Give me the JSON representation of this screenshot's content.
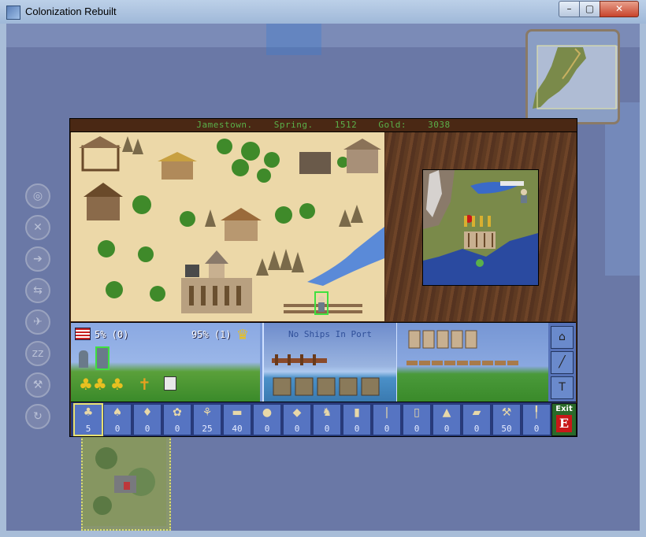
{
  "window": {
    "title": "Colonization Rebuilt",
    "minimize": "–",
    "maximize": "▢",
    "close": "✕"
  },
  "colony": {
    "name": "Jamestown.",
    "season": "Spring.",
    "year": "1512",
    "gold_label": "Gold:",
    "gold_value": "3038"
  },
  "side_buttons": [
    {
      "icon": "target-icon",
      "glyph": "◎"
    },
    {
      "icon": "crossed-tools-icon",
      "glyph": "✕"
    },
    {
      "icon": "arrow-icon",
      "glyph": "➔"
    },
    {
      "icon": "fork-arrows-icon",
      "glyph": "⇆"
    },
    {
      "icon": "bird-icon",
      "glyph": "✈"
    },
    {
      "icon": "sleep-icon",
      "glyph": "zz"
    },
    {
      "icon": "plow-icon",
      "glyph": "⚒"
    },
    {
      "icon": "cycle-icon",
      "glyph": "↻"
    }
  ],
  "status": {
    "rebels_pct": "5% (0)",
    "tories_pct": "95% (1)",
    "no_ships": "No Ships In Port"
  },
  "panel_buttons": [
    {
      "icon": "building-icon",
      "glyph": "⌂"
    },
    {
      "icon": "musket-icon",
      "glyph": "╱"
    },
    {
      "icon": "hammer-icon",
      "glyph": "T"
    }
  ],
  "goods": [
    {
      "name": "food",
      "icon": "corn-icon",
      "glyph": "♣",
      "value": "5"
    },
    {
      "name": "sugar",
      "icon": "sugar-icon",
      "glyph": "♠",
      "value": "0"
    },
    {
      "name": "tobacco",
      "icon": "tobacco-icon",
      "glyph": "♦",
      "value": "0"
    },
    {
      "name": "cotton",
      "icon": "cotton-icon",
      "glyph": "✿",
      "value": "0"
    },
    {
      "name": "furs",
      "icon": "furs-icon",
      "glyph": "⚘",
      "value": "25"
    },
    {
      "name": "lumber",
      "icon": "lumber-icon",
      "glyph": "▬",
      "value": "40"
    },
    {
      "name": "ore",
      "icon": "ore-icon",
      "glyph": "●",
      "value": "0"
    },
    {
      "name": "silver",
      "icon": "silver-icon",
      "glyph": "◆",
      "value": "0"
    },
    {
      "name": "horses",
      "icon": "horse-icon",
      "glyph": "♞",
      "value": "0"
    },
    {
      "name": "rum",
      "icon": "rum-icon",
      "glyph": "▮",
      "value": "0"
    },
    {
      "name": "cigars",
      "icon": "cigar-icon",
      "glyph": "|",
      "value": "0"
    },
    {
      "name": "cloth",
      "icon": "cloth-icon",
      "glyph": "▯",
      "value": "0"
    },
    {
      "name": "coats",
      "icon": "coat-icon",
      "glyph": "▲",
      "value": "0"
    },
    {
      "name": "trade-goods",
      "icon": "trade-goods-icon",
      "glyph": "▰",
      "value": "0"
    },
    {
      "name": "tools",
      "icon": "tools-icon",
      "glyph": "⚒",
      "value": "50"
    },
    {
      "name": "muskets",
      "icon": "musket-icon",
      "glyph": "╿",
      "value": "0"
    }
  ],
  "exit": {
    "label": "Exit",
    "glyph": "E"
  }
}
